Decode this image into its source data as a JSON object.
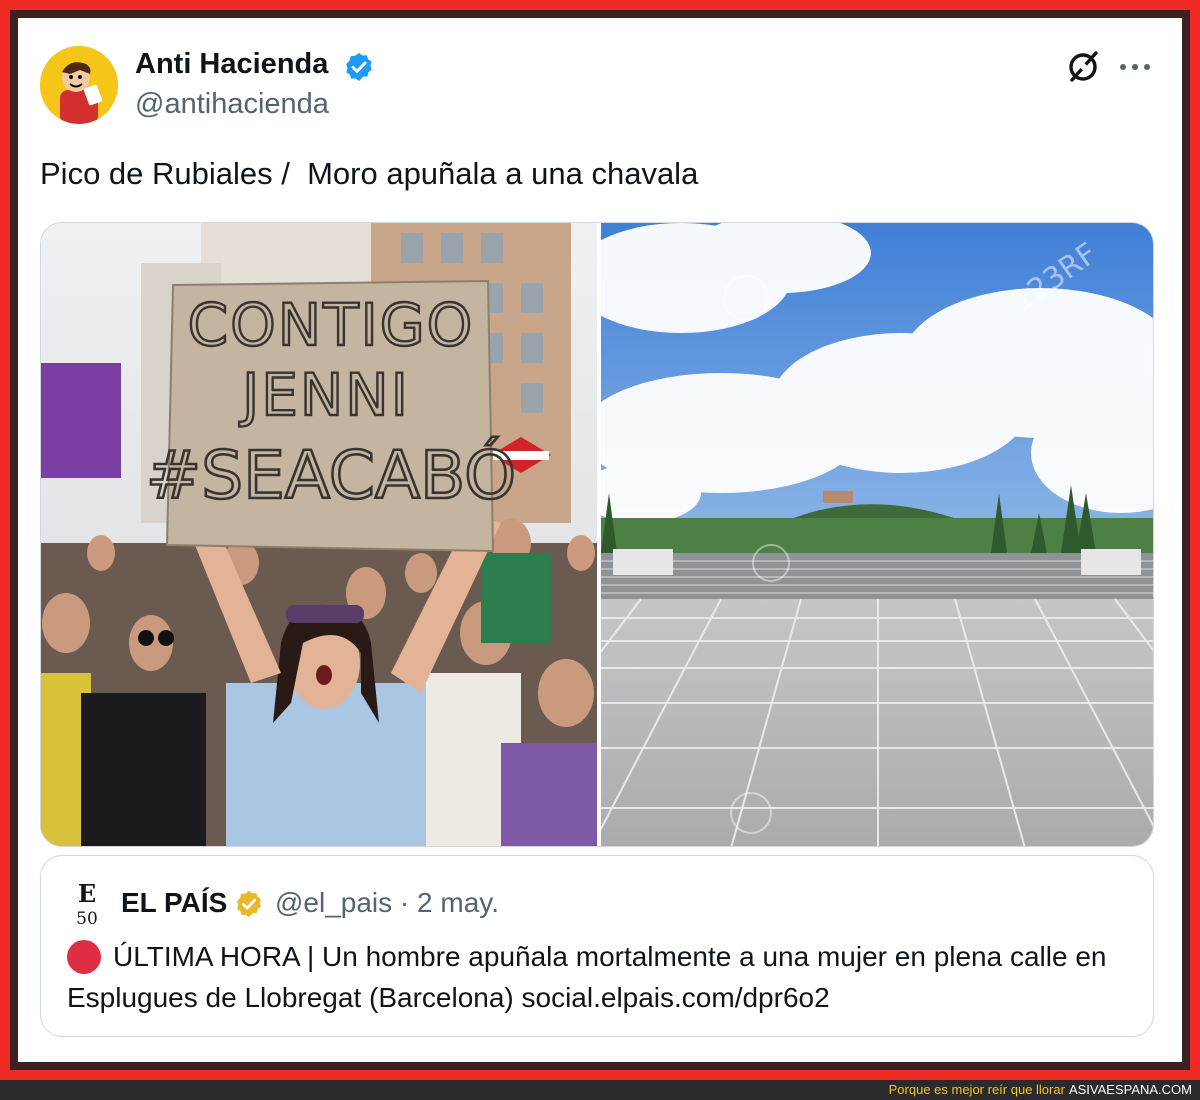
{
  "tweet": {
    "author_name": "Anti Hacienda",
    "author_handle": "@antihacienda",
    "text": "Pico de Rubiales /  Moro apuñala a una chavala",
    "verified_color": "#1d9bf0"
  },
  "media": {
    "left_sign_lines": [
      "CONTIGO",
      "JENNI",
      "#SEACABÓ"
    ],
    "right_watermark": "123RF"
  },
  "quote": {
    "author_name": "EL PAÍS",
    "meta": "@el_pais · 2 may.",
    "logo_letters": [
      "E",
      "50"
    ],
    "body": "ÚLTIMA HORA | Un hombre apuñala mortalmente a una mujer en plena calle en Esplugues de Llobregat (Barcelona) social.elpais.com/dpr6o2",
    "badge_color": "#e8b829",
    "alert_color": "#dd2e44"
  },
  "footer": {
    "tagline": "Porque es mejor reír que llorar",
    "brand": "ASIVAESPANA.COM"
  }
}
